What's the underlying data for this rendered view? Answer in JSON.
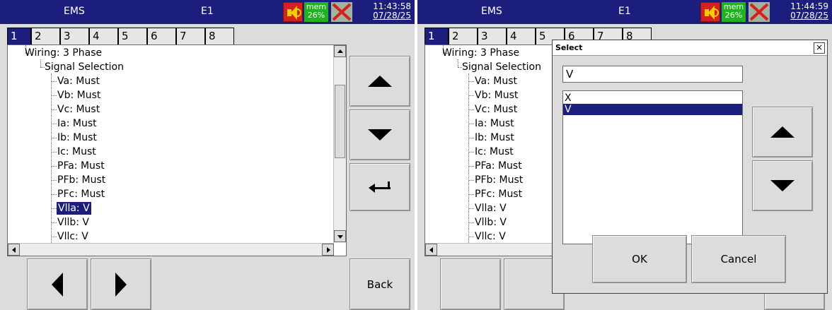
{
  "panels": [
    {
      "title_app": "EMS",
      "title_unit": "E1",
      "mem_label": "mem",
      "mem_value": "26%",
      "time": "11:43:58",
      "date": "07/28/25",
      "tabs": [
        "1",
        "2",
        "3",
        "4",
        "5",
        "6",
        "7",
        "8"
      ],
      "active_tab": "1",
      "tree": {
        "wiring": "Wiring: 3 Phase",
        "signal": "Signal Selection",
        "items": [
          "Va: Must",
          "Vb: Must",
          "Vc: Must",
          "Ia: Must",
          "Ib: Must",
          "Ic: Must",
          "PFa: Must",
          "PFb: Must",
          "PFc: Must",
          "Vlla: V",
          "Vllb: V",
          "Vllc: V"
        ],
        "selected": "Vlla: V"
      },
      "buttons": {
        "back": "Back"
      }
    },
    {
      "title_app": "EMS",
      "title_unit": "E1",
      "mem_label": "mem",
      "mem_value": "26%",
      "time": "11:44:59",
      "date": "07/28/25",
      "tabs": [
        "1",
        "2",
        "3",
        "4",
        "5",
        "6",
        "7",
        "8"
      ],
      "active_tab": "1",
      "tree": {
        "wiring": "Wiring: 3 Phase",
        "signal": "Signal Selection",
        "items": [
          "Va: Must",
          "Vb: Must",
          "Vc: Must",
          "Ia: Must",
          "Ib: Must",
          "Ic: Must",
          "PFa: Must",
          "PFb: Must",
          "PFc: Must",
          "Vlla: V",
          "Vllb: V",
          "Vllc: V"
        ]
      },
      "dialog": {
        "title": "Select",
        "input_value": "V",
        "options": [
          "X",
          "V"
        ],
        "selected": "V",
        "ok": "OK",
        "cancel": "Cancel"
      }
    }
  ],
  "colors": {
    "titlebar": "#1c1e7e",
    "selection": "#1c1e7e",
    "panel_bg": "#dcdcdc",
    "speaker_bg": "#d8201c",
    "mem_bg": "#1fb31f"
  }
}
